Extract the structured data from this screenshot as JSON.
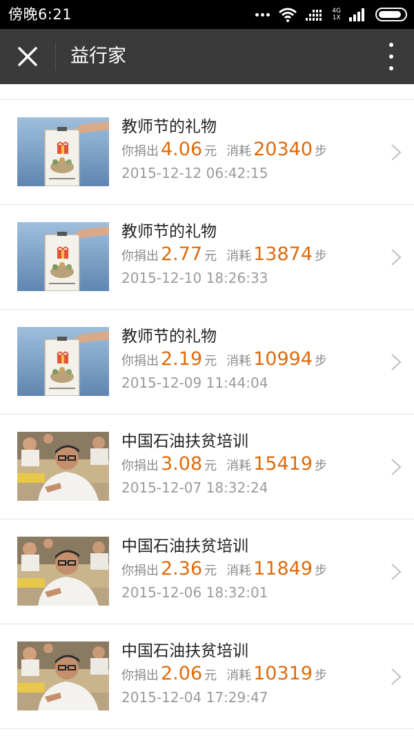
{
  "status_bar": {
    "time": "傍晚6:21",
    "network_top": "4G",
    "network_bottom": "1X",
    "icons": [
      "more-dots-icon",
      "wifi-icon",
      "signal-icon",
      "network-4g-icon",
      "cellular-signal-icon",
      "battery-icon"
    ]
  },
  "app_bar": {
    "title": "益行家",
    "close_icon": "close-icon",
    "more_icon": "more-vertical-icon",
    "background": "#3a3a3a"
  },
  "labels": {
    "donated_prefix": "你捐出",
    "currency": "元",
    "consumed_prefix": "消耗",
    "steps_unit": "步"
  },
  "accent_color": "#e06a0a",
  "donations": [
    {
      "title": "教师节的礼物",
      "amount": "4.06",
      "steps": "20340",
      "datetime": "2015-12-12 06:42:15",
      "thumb": "gift-donation-box"
    },
    {
      "title": "教师节的礼物",
      "amount": "2.77",
      "steps": "13874",
      "datetime": "2015-12-10 18:26:33",
      "thumb": "gift-donation-box"
    },
    {
      "title": "教师节的礼物",
      "amount": "2.19",
      "steps": "10994",
      "datetime": "2015-12-09 11:44:04",
      "thumb": "gift-donation-box"
    },
    {
      "title": "中国石油扶贫培训",
      "amount": "3.08",
      "steps": "15419",
      "datetime": "2015-12-07 18:32:24",
      "thumb": "classroom-photo"
    },
    {
      "title": "中国石油扶贫培训",
      "amount": "2.36",
      "steps": "11849",
      "datetime": "2015-12-06 18:32:01",
      "thumb": "classroom-photo"
    },
    {
      "title": "中国石油扶贫培训",
      "amount": "2.06",
      "steps": "10319",
      "datetime": "2015-12-04 17:29:47",
      "thumb": "classroom-photo"
    }
  ]
}
